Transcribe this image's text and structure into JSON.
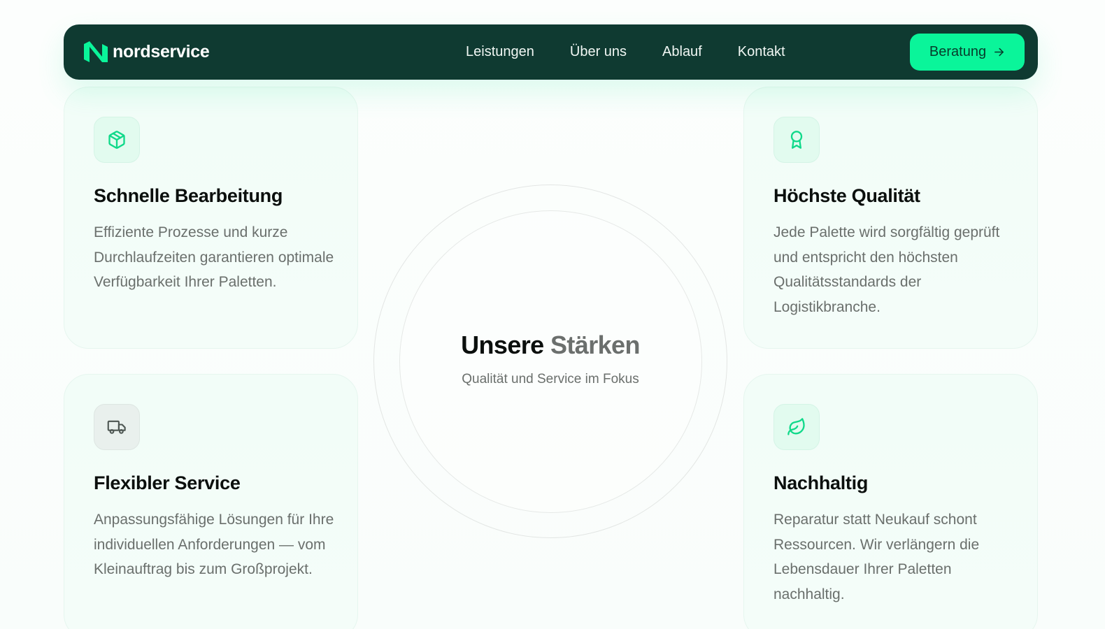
{
  "nav": {
    "brand": "nordservice",
    "links": [
      "Leistungen",
      "Über uns",
      "Ablauf",
      "Kontakt"
    ],
    "cta_label": "Beratung"
  },
  "center": {
    "title_main": "Unsere",
    "title_accent": "Stärken",
    "subtitle": "Qualität und Service im Fokus"
  },
  "cards": [
    {
      "icon": "box-icon",
      "title": "Schnelle Bearbeitung",
      "text": "Effiziente Prozesse und kurze Durchlaufzeiten garantieren optimale Verfügbarkeit Ihrer Paletten."
    },
    {
      "icon": "award-icon",
      "title": "Höchste Qualität",
      "text": "Jede Palette wird sorgfältig geprüft und entspricht den höchsten Qualitätsstandards der Logistikbranche."
    },
    {
      "icon": "truck-icon",
      "title": "Flexibler Service",
      "text": "Anpassungsfähige Lösungen für Ihre individuellen Anforderungen — vom Kleinauftrag bis zum Großprojekt."
    },
    {
      "icon": "leaf-icon",
      "title": "Nachhaltig",
      "text": "Reparatur statt Neukauf schont Ressourcen. Wir verlängern die Lebensdauer Ihrer Paletten nachhaltig."
    }
  ],
  "colors": {
    "nav_bg": "#0f3a31",
    "accent": "#0af59a",
    "icon_green": "#10d98a"
  }
}
